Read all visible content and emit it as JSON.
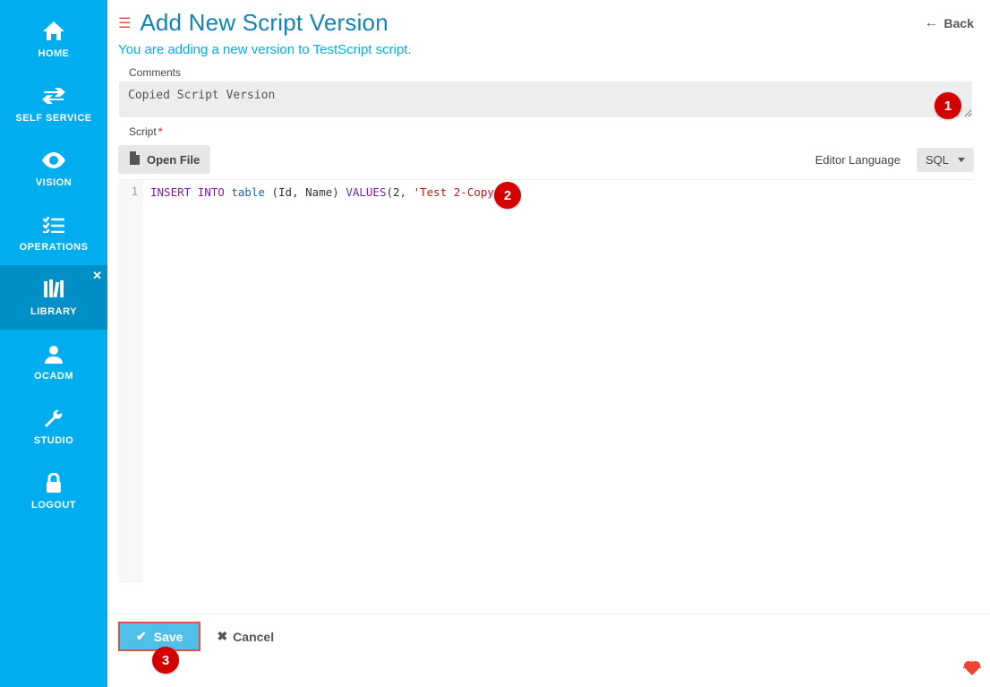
{
  "sidebar": {
    "items": [
      {
        "label": "HOME",
        "icon": "home"
      },
      {
        "label": "SELF SERVICE",
        "icon": "swap"
      },
      {
        "label": "VISION",
        "icon": "eye"
      },
      {
        "label": "OPERATIONS",
        "icon": "list"
      },
      {
        "label": "LIBRARY",
        "icon": "books",
        "active": true,
        "closable": true
      },
      {
        "label": "OCADM",
        "icon": "user"
      },
      {
        "label": "STUDIO",
        "icon": "wrench"
      },
      {
        "label": "LOGOUT",
        "icon": "lock"
      }
    ]
  },
  "header": {
    "title": "Add New Script Version",
    "back_label": "Back",
    "subtitle": "You are adding a new version to TestScript script."
  },
  "comments": {
    "label": "Comments",
    "value": "Copied Script Version"
  },
  "script": {
    "label": "Script",
    "open_file_label": "Open File",
    "language_label": "Editor Language",
    "language_value": "SQL",
    "code_tokens": [
      {
        "t": "INSERT",
        "c": "kw"
      },
      {
        "t": " "
      },
      {
        "t": "INTO",
        "c": "kw"
      },
      {
        "t": " "
      },
      {
        "t": "table",
        "c": "tbl-word"
      },
      {
        "t": " ("
      },
      {
        "t": "Id",
        "c": "id"
      },
      {
        "t": ", "
      },
      {
        "t": "Name",
        "c": "id"
      },
      {
        "t": ") "
      },
      {
        "t": "VALUES",
        "c": "kw"
      },
      {
        "t": "("
      },
      {
        "t": "2",
        "c": "num"
      },
      {
        "t": ", "
      },
      {
        "t": "'Test 2-Copy'",
        "c": "str"
      },
      {
        "t": ")"
      }
    ],
    "gutter_line": "1"
  },
  "actions": {
    "save_label": "Save",
    "cancel_label": "Cancel"
  },
  "callouts": {
    "c1": "1",
    "c2": "2",
    "c3": "3"
  }
}
